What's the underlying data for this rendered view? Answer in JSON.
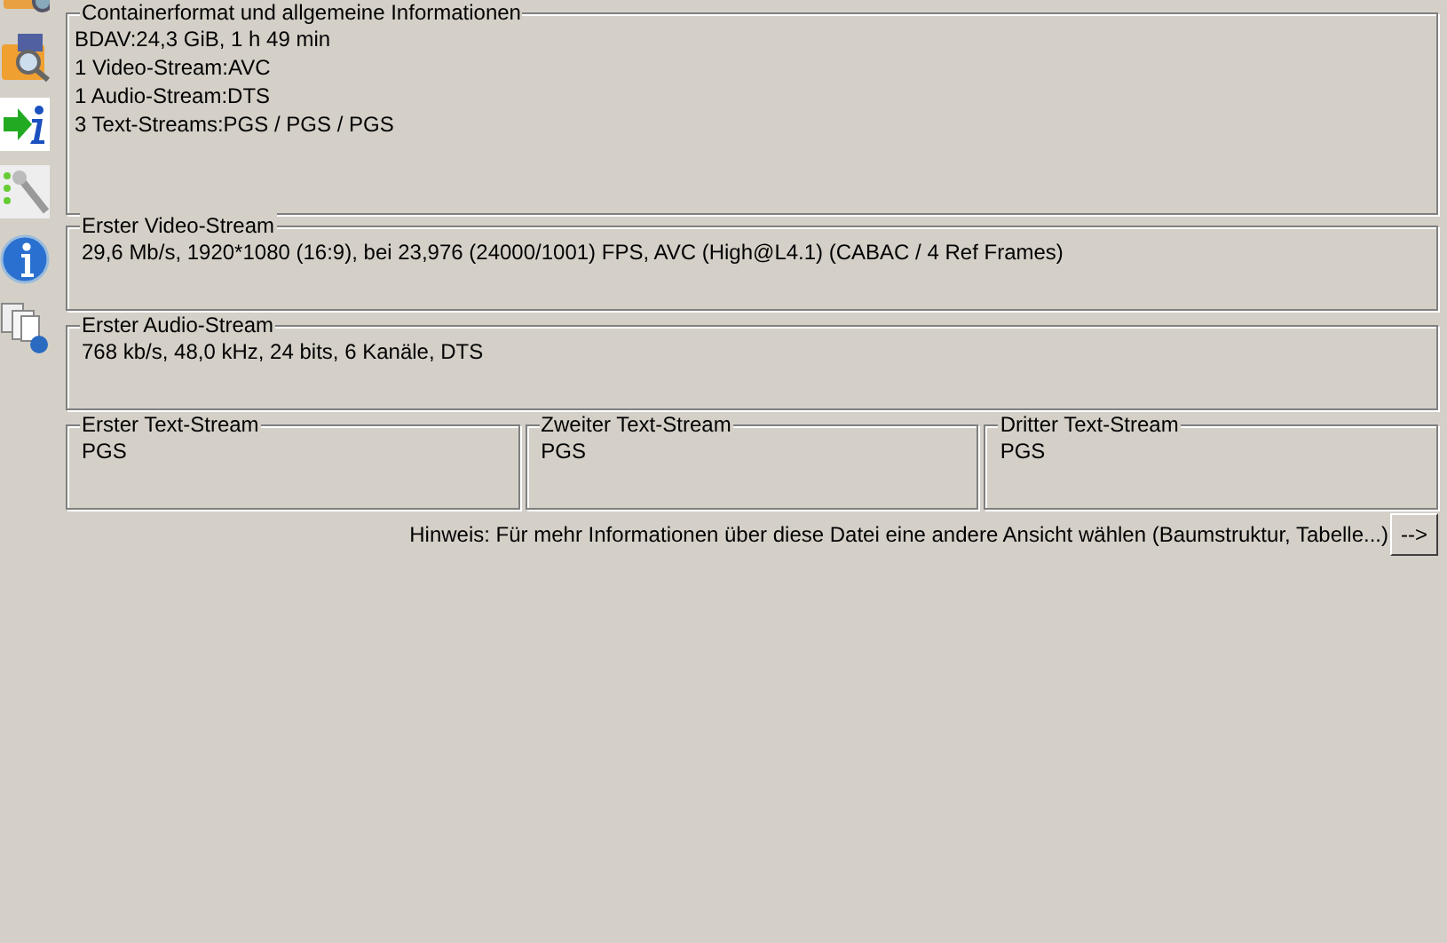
{
  "general": {
    "title": "Containerformat und allgemeine Informationen",
    "lines": [
      "BDAV:24,3 GiB, 1 h 49 min",
      "1 Video-Stream:AVC",
      "1 Audio-Stream:DTS",
      "3 Text-Streams:PGS / PGS / PGS"
    ]
  },
  "video": {
    "title": "Erster Video-Stream",
    "lines": [
      "29,6 Mb/s, 1920*1080 (16:9), bei 23,976 (24000/1001) FPS, AVC (High@L4.1) (CABAC / 4 Ref Frames)"
    ]
  },
  "audio": {
    "title": "Erster Audio-Stream",
    "lines": [
      "768 kb/s, 48,0 kHz, 24 bits, 6 Kanäle, DTS"
    ]
  },
  "text_streams": [
    {
      "title": "Erster Text-Stream",
      "lines": [
        "PGS"
      ]
    },
    {
      "title": "Zweiter Text-Stream",
      "lines": [
        "PGS"
      ]
    },
    {
      "title": "Dritter Text-Stream",
      "lines": [
        "PGS"
      ]
    }
  ],
  "hint": "Hinweis: Für mehr Informationen über diese Datei eine andere Ansicht wählen (Baumstruktur, Tabelle...)",
  "next_button": "-->"
}
